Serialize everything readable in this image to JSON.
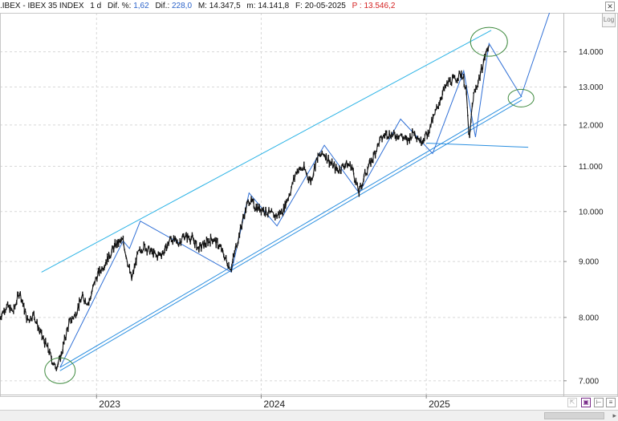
{
  "header": {
    "symbol": ".IBEX - IBEX 35 INDEX",
    "interval": "1 d",
    "dif_pct_label": "Dif. %:",
    "dif_pct_value": "1,62",
    "dif_label": "Dif.:",
    "dif_value": "228,0",
    "max_label": "M:",
    "max_value": "14.347,5",
    "min_label": "m:",
    "min_value": "14.141,8",
    "date_label": "F:",
    "date_value": "20-05-2025",
    "prev_label": "P :",
    "prev_value": "13.546,2"
  },
  "controls": {
    "log_label": "Log",
    "close_label": "✕"
  },
  "colors": {
    "price": "#111111",
    "trend_line": "#2a8fe0",
    "channel_line": "#2bb3e6",
    "zigzag": "#2f6fd6",
    "circle": "#3e8a3e",
    "grid": "#d8d8d8"
  },
  "chart_data": {
    "type": "line",
    "scale": "log",
    "xlim": [
      "2022-06-01",
      "2025-11-01"
    ],
    "ylim": [
      6800,
      15200
    ],
    "y_ticks": [
      7000,
      8000,
      9000,
      10000,
      11000,
      12000,
      13000,
      14000
    ],
    "y_tick_labels": [
      "7.000",
      "8.000",
      "9.000",
      "10.000",
      "11.000",
      "12.000",
      "13.000",
      "14.000"
    ],
    "x_ticks": [
      "2023-01-01",
      "2024-01-01",
      "2025-01-01"
    ],
    "x_tick_labels": [
      "2023",
      "2024",
      "2025"
    ],
    "grid": true,
    "series": [
      {
        "points": [
          [
            "2022-06-01",
            8000
          ],
          [
            "2022-06-15",
            8200
          ],
          [
            "2022-07-01",
            8100
          ],
          [
            "2022-07-15",
            8450
          ],
          [
            "2022-08-01",
            7950
          ],
          [
            "2022-08-15",
            8050
          ],
          [
            "2022-09-01",
            7700
          ],
          [
            "2022-09-15",
            7500
          ],
          [
            "2022-10-01",
            7200
          ],
          [
            "2022-10-12",
            7300
          ],
          [
            "2022-11-01",
            7900
          ],
          [
            "2022-11-15",
            8050
          ],
          [
            "2022-12-01",
            8350
          ],
          [
            "2022-12-15",
            8250
          ],
          [
            "2023-01-01",
            8700
          ],
          [
            "2023-01-15",
            8900
          ],
          [
            "2023-02-01",
            9150
          ],
          [
            "2023-02-15",
            9350
          ],
          [
            "2023-03-01",
            9400
          ],
          [
            "2023-03-10",
            9050
          ],
          [
            "2023-03-20",
            8650
          ],
          [
            "2023-04-01",
            9100
          ],
          [
            "2023-04-15",
            9300
          ],
          [
            "2023-05-01",
            9200
          ],
          [
            "2023-05-15",
            9100
          ],
          [
            "2023-06-01",
            9200
          ],
          [
            "2023-06-15",
            9450
          ],
          [
            "2023-07-01",
            9350
          ],
          [
            "2023-07-15",
            9500
          ],
          [
            "2023-08-01",
            9450
          ],
          [
            "2023-08-15",
            9250
          ],
          [
            "2023-09-01",
            9350
          ],
          [
            "2023-09-15",
            9450
          ],
          [
            "2023-10-01",
            9300
          ],
          [
            "2023-10-20",
            8950
          ],
          [
            "2023-10-27",
            8880
          ],
          [
            "2023-11-10",
            9400
          ],
          [
            "2023-11-24",
            9900
          ],
          [
            "2023-12-05",
            10250
          ],
          [
            "2023-12-20",
            10100
          ],
          [
            "2024-01-05",
            10050
          ],
          [
            "2024-01-20",
            9950
          ],
          [
            "2024-02-05",
            9900
          ],
          [
            "2024-02-20",
            10050
          ],
          [
            "2024-03-05",
            10400
          ],
          [
            "2024-03-20",
            10900
          ],
          [
            "2024-04-05",
            10950
          ],
          [
            "2024-04-20",
            10650
          ],
          [
            "2024-05-05",
            11200
          ],
          [
            "2024-05-20",
            11300
          ],
          [
            "2024-06-05",
            11050
          ],
          [
            "2024-06-20",
            10900
          ],
          [
            "2024-07-05",
            11050
          ],
          [
            "2024-07-20",
            11000
          ],
          [
            "2024-08-05",
            10400
          ],
          [
            "2024-08-20",
            10850
          ],
          [
            "2024-09-05",
            11200
          ],
          [
            "2024-09-20",
            11600
          ],
          [
            "2024-10-05",
            11800
          ],
          [
            "2024-10-20",
            11750
          ],
          [
            "2024-11-05",
            11750
          ],
          [
            "2024-11-20",
            11600
          ],
          [
            "2024-12-05",
            11850
          ],
          [
            "2024-12-20",
            11600
          ],
          [
            "2025-01-05",
            11800
          ],
          [
            "2025-01-20",
            12250
          ],
          [
            "2025-02-05",
            12800
          ],
          [
            "2025-02-20",
            13150
          ],
          [
            "2025-03-05",
            13200
          ],
          [
            "2025-03-20",
            13400
          ],
          [
            "2025-03-30",
            13000
          ],
          [
            "2025-04-07",
            11600
          ],
          [
            "2025-04-15",
            12700
          ],
          [
            "2025-04-30",
            13300
          ],
          [
            "2025-05-10",
            13800
          ],
          [
            "2025-05-20",
            14200
          ]
        ]
      }
    ],
    "channel_lines": [
      {
        "from": [
          "2022-10-12",
          7150
        ],
        "to": [
          "2025-08-01",
          12650
        ]
      },
      {
        "from": [
          "2022-10-12",
          7200
        ],
        "to": [
          "2025-08-01",
          12750
        ]
      },
      {
        "from": [
          "2022-09-01",
          8800
        ],
        "to": [
          "2025-05-25",
          14650
        ]
      },
      {
        "from": [
          "2025-01-01",
          11550
        ],
        "to": [
          "2025-08-15",
          11450
        ]
      }
    ],
    "zigzag": [
      [
        "2022-10-12",
        7200
      ],
      [
        "2023-03-01",
        9400
      ],
      [
        "2023-03-15",
        9250
      ],
      [
        "2023-04-08",
        9800
      ],
      [
        "2023-10-27",
        8800
      ],
      [
        "2023-12-05",
        10400
      ],
      [
        "2024-02-05",
        9700
      ],
      [
        "2024-05-20",
        11500
      ],
      [
        "2024-08-05",
        10400
      ],
      [
        "2024-11-05",
        12150
      ],
      [
        "2025-01-15",
        11300
      ],
      [
        "2025-03-25",
        13450
      ],
      [
        "2025-04-20",
        11700
      ],
      [
        "2025-05-20",
        14250
      ],
      [
        "2025-07-30",
        12750
      ],
      [
        "2025-10-01",
        15200
      ]
    ],
    "circles": [
      {
        "center": [
          "2022-10-12",
          7150
        ]
      },
      {
        "center": [
          "2025-05-20",
          14300
        ]
      },
      {
        "center": [
          "2025-07-30",
          12700
        ]
      }
    ]
  }
}
